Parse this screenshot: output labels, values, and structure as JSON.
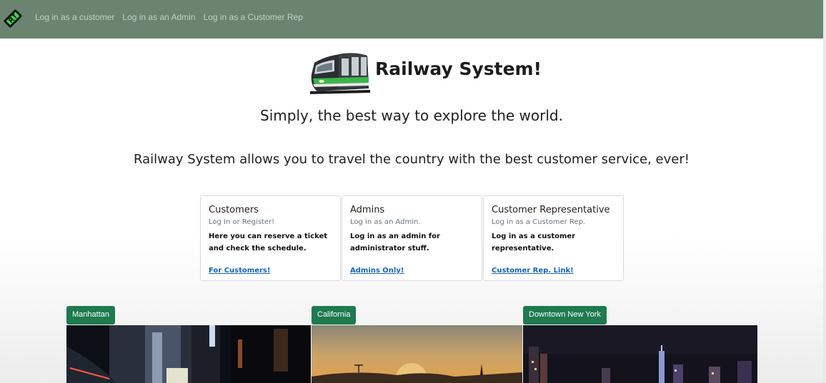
{
  "navbar": {
    "logo_icon": "train-ticket-icon",
    "links": [
      "Log in as a customer",
      "Log in as an Admin",
      "Log in as a Customer Rep"
    ],
    "background": "#6a8470"
  },
  "header": {
    "title": "Railway System!",
    "tagline": "Simply, the best way to explore the world.",
    "description": "Railway System allows you to travel the country with the best customer service, ever!"
  },
  "cards": [
    {
      "title": "Customers",
      "subtitle": "Log In or Register!",
      "text": "Here you can reserve a ticket and check the schedule.",
      "link": "For Customers!"
    },
    {
      "title": "Admins",
      "subtitle": "Log in as an Admin.",
      "text": "Log in as an admin for administrator stuff.",
      "link": "Admins Only!"
    },
    {
      "title": "Customer Representative",
      "subtitle": "Log in as a Customer Rep.",
      "text": "Log in as a customer representative.",
      "link": "Customer Rep. Link!"
    }
  ],
  "gallery": [
    {
      "label": "Manhattan",
      "image": "manhattan-night-photo"
    },
    {
      "label": "California",
      "image": "california-sunset-photo"
    },
    {
      "label": "Downtown New York",
      "image": "new-york-skyline-photo"
    }
  ],
  "colors": {
    "badge": "#1e7a4f",
    "link": "#1565c0",
    "train_stripe": "#3bb54a"
  }
}
